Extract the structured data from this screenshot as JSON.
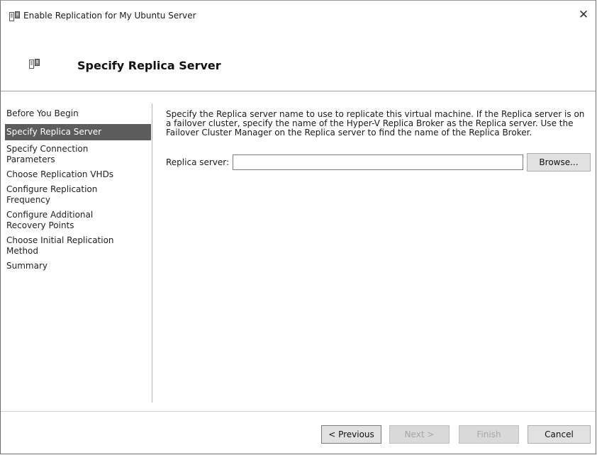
{
  "window": {
    "title": "Enable Replication for My Ubuntu Server",
    "close_glyph": "✕",
    "app_icon": "server-replication-icon"
  },
  "header": {
    "heading": "Specify Replica Server",
    "icon": "server-replication-icon"
  },
  "nav": {
    "items": [
      {
        "label": "Before You Begin",
        "active": false
      },
      {
        "label": "Specify Replica Server",
        "active": true
      },
      {
        "label": "Specify Connection Parameters",
        "active": false
      },
      {
        "label": "Choose Replication VHDs",
        "active": false
      },
      {
        "label": "Configure Replication Frequency",
        "active": false
      },
      {
        "label": "Configure Additional Recovery Points",
        "active": false
      },
      {
        "label": "Choose Initial Replication Method",
        "active": false
      },
      {
        "label": "Summary",
        "active": false
      }
    ]
  },
  "main": {
    "description": "Specify the Replica server name to use to replicate this virtual machine. If the Replica server is on a failover cluster, specify the name of the Hyper-V Replica Broker as the Replica server. Use the Failover Cluster Manager on the Replica server to find the name of the Replica Broker.",
    "replica_label": "Replica server:",
    "replica_value": "",
    "browse_label": "Browse..."
  },
  "footer": {
    "previous_label": "< Previous",
    "next_label": "Next >",
    "finish_label": "Finish",
    "cancel_label": "Cancel"
  },
  "colors": {
    "active_nav_bg": "#5c5c5c",
    "button_bg": "#e1e1e1",
    "disabled_text": "#a6a6a6"
  }
}
